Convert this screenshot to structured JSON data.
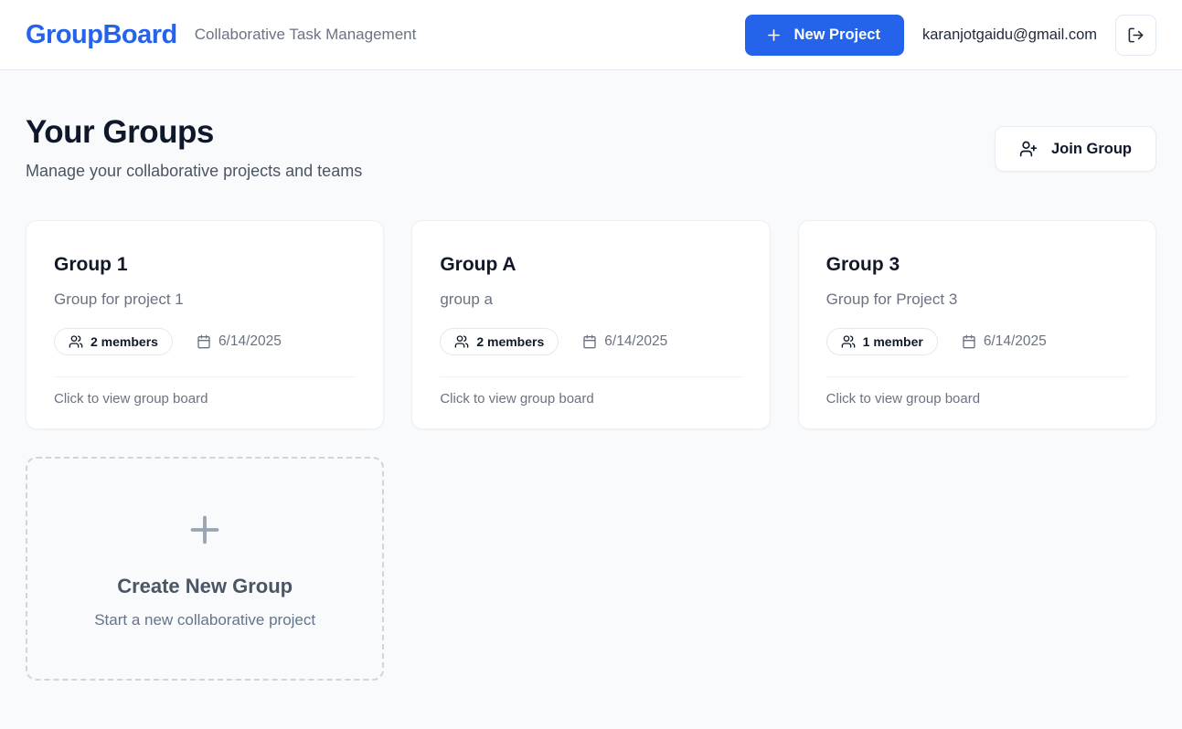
{
  "header": {
    "logo": "GroupBoard",
    "tagline": "Collaborative Task Management",
    "new_project_label": "New Project",
    "user_email": "karanjotgaidu@gmail.com",
    "logout_icon": "log-out-icon",
    "plus_icon": "plus-icon"
  },
  "page": {
    "title": "Your Groups",
    "subtitle": "Manage your collaborative projects and teams",
    "join_group_label": "Join Group",
    "join_group_icon": "user-plus-icon"
  },
  "groups": [
    {
      "name": "Group 1",
      "description": "Group for project 1",
      "members": "2 members",
      "date": "6/14/2025",
      "footer": "Click to view group board"
    },
    {
      "name": "Group A",
      "description": "group a",
      "members": "2 members",
      "date": "6/14/2025",
      "footer": "Click to view group board"
    },
    {
      "name": "Group 3",
      "description": "Group for Project 3",
      "members": "1 member",
      "date": "6/14/2025",
      "footer": "Click to view group board"
    }
  ],
  "create_card": {
    "title": "Create New Group",
    "subtitle": "Start a new collaborative project",
    "icon": "plus-icon"
  },
  "colors": {
    "accent_blue": "#2563eb",
    "page_background": "#f8fafc",
    "card_background": "#ffffff",
    "text_dark": "#0f172a",
    "text_gray": "#6b7280",
    "border_light": "#e8ecf2"
  }
}
